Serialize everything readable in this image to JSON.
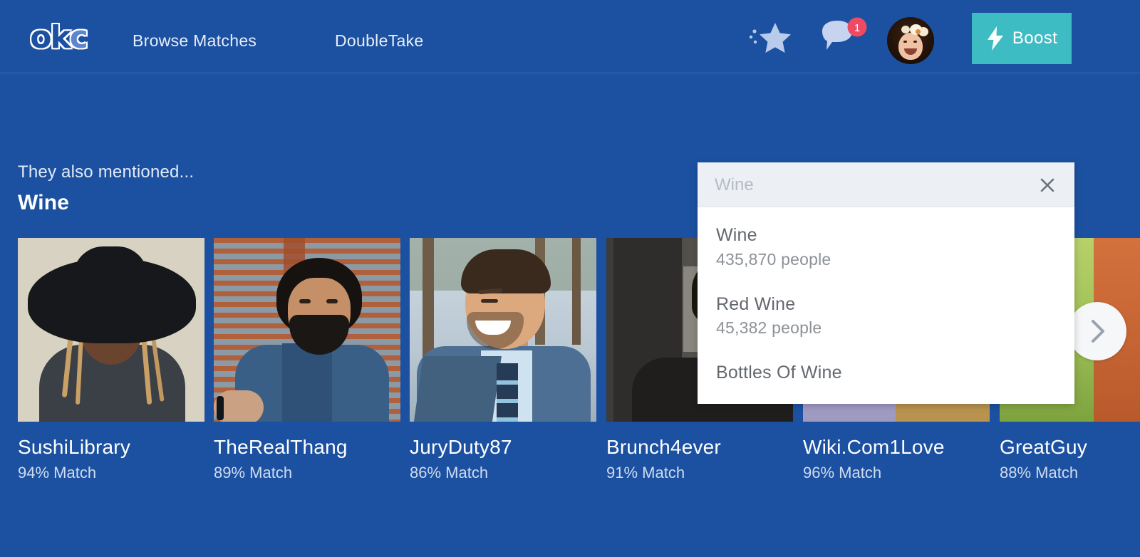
{
  "header": {
    "logo_text": "okc",
    "nav": [
      {
        "label": "Browse Matches",
        "name": "nav-browse-matches"
      },
      {
        "label": "DoubleTake",
        "name": "nav-doubletake"
      }
    ],
    "star_icon": "star-icon",
    "messages_icon": "speech-bubble-icon",
    "messages_badge": "1",
    "avatar_icon": "user-avatar",
    "boost_label": "Boost",
    "boost_icon": "lightning-bolt-icon",
    "boost_color": "#3dbcc4",
    "badge_color": "#ef4a63",
    "background_color": "#1c51a1"
  },
  "main": {
    "eyebrow": "They also mentioned...",
    "title": "Wine",
    "next_arrow_icon": "chevron-right-icon",
    "cards": [
      {
        "name": "SushiLibrary",
        "match": "94% Match",
        "photo": "p1"
      },
      {
        "name": "TheRealThang",
        "match": "89% Match",
        "photo": "p2"
      },
      {
        "name": "JuryDuty87",
        "match": "86% Match",
        "photo": "p3"
      },
      {
        "name": "Brunch4ever",
        "match": "91% Match",
        "photo": "p4"
      },
      {
        "name": "Wiki.Com1Love",
        "match": "96% Match",
        "photo": "p5"
      },
      {
        "name": "GreatGuy",
        "match": "88% Match",
        "photo": "p6"
      }
    ]
  },
  "search_panel": {
    "input_value": "Wine",
    "input_placeholder": "Wine",
    "close_icon": "close-icon",
    "results": [
      {
        "name": "Wine",
        "count": "435,870 people"
      },
      {
        "name": "Red Wine",
        "count": "45,382 people"
      },
      {
        "name": "Bottles Of Wine",
        "count": ""
      }
    ]
  }
}
